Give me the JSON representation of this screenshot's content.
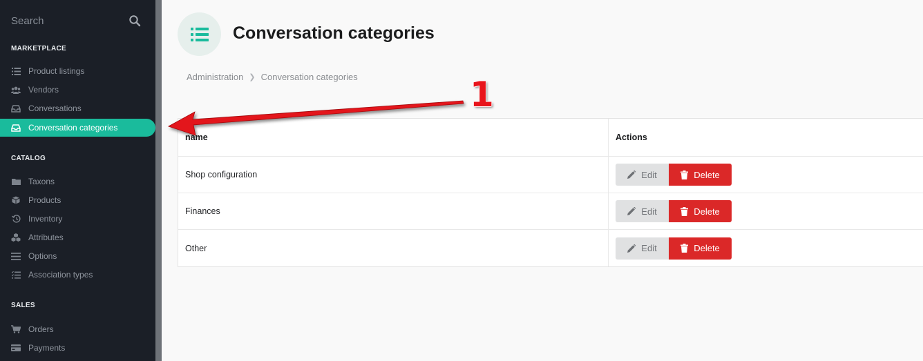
{
  "sidebar": {
    "search_label": "Search",
    "sections": [
      {
        "title": "MARKETPLACE",
        "items": [
          {
            "label": "Product listings",
            "icon": "list-icon"
          },
          {
            "label": "Vendors",
            "icon": "users-icon"
          },
          {
            "label": "Conversations",
            "icon": "inbox-icon"
          },
          {
            "label": "Conversation categories",
            "icon": "inbox-icon",
            "active": true
          }
        ]
      },
      {
        "title": "CATALOG",
        "items": [
          {
            "label": "Taxons",
            "icon": "folder-icon"
          },
          {
            "label": "Products",
            "icon": "cube-icon"
          },
          {
            "label": "Inventory",
            "icon": "history-icon"
          },
          {
            "label": "Attributes",
            "icon": "cubes-icon"
          },
          {
            "label": "Options",
            "icon": "options-icon"
          },
          {
            "label": "Association types",
            "icon": "tasks-icon"
          }
        ]
      },
      {
        "title": "SALES",
        "items": [
          {
            "label": "Orders",
            "icon": "cart-icon"
          },
          {
            "label": "Payments",
            "icon": "credit-card-icon"
          }
        ]
      }
    ]
  },
  "main": {
    "title": "Conversation categories",
    "breadcrumb": [
      "Administration",
      "Conversation categories"
    ],
    "table": {
      "headers": {
        "name": "name",
        "actions": "Actions"
      },
      "rows": [
        {
          "name": "Shop configuration"
        },
        {
          "name": "Finances"
        },
        {
          "name": "Other"
        }
      ],
      "edit_label": "Edit",
      "delete_label": "Delete"
    }
  },
  "annotation": {
    "number": "1"
  },
  "colors": {
    "accent": "#1abb9c",
    "sidebar_bg": "#1b1f27",
    "delete": "#db2828",
    "annotation": "#e8141b"
  }
}
